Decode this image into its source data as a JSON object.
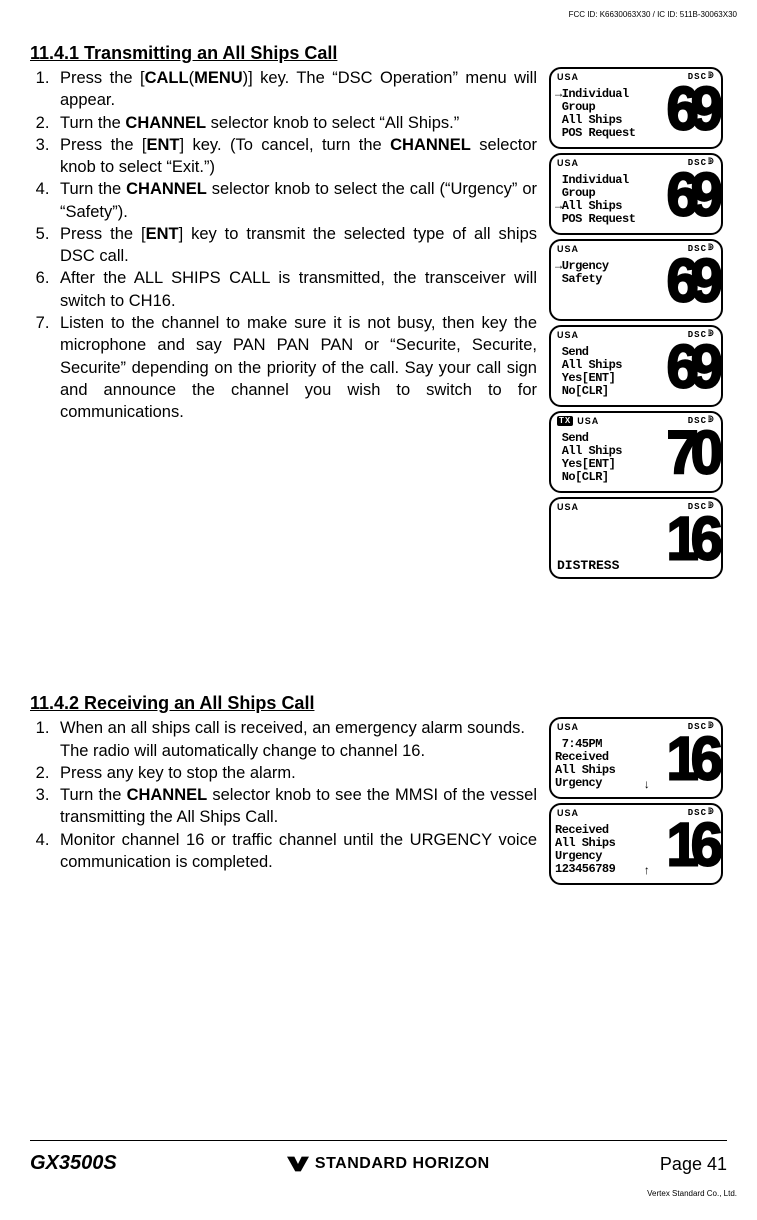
{
  "header_fine": "FCC ID: K6630063X30 / IC ID: 511B-30063X30",
  "section1": {
    "heading": "11.4.1  Transmitting an All Ships Call",
    "steps": [
      "Press the [<b>CALL</b>(<b>MENU</b>)] key. The “DSC Operation” menu will appear.",
      "Turn the <b>CHANNEL</b> selector knob to select “All Ships.”",
      "Press the [<b>ENT</b>] key. (To cancel, turn the <b>CHANNEL</b> selector knob to select “Exit.”)",
      "Turn the <b>CHANNEL</b> selector knob to select the call (“Urgency” or “Safety”).",
      "Press the [<b>ENT</b>] key to transmit the selected type of all ships DSC call.",
      "After the ALL SHIPS CALL is transmitted, the transceiver will switch to CH16.",
      "Listen to the channel to make sure it is not busy, then key the microphone and say PAN PAN PAN or “Securite, Securite, Securite” depending on the priority of the call. Say your call sign and announce the channel you wish to switch to for communications."
    ]
  },
  "section2": {
    "heading": "11.4.2 Receiving an All Ships Call",
    "steps": [
      "When an all ships call is received, an emergency alarm sounds.<br>The radio will automatically change to channel 16.",
      "Press any key to stop the alarm.",
      "Turn the <b>CHANNEL</b> selector knob to see the MMSI of the vessel transmitting the All Ships Call.",
      "Monitor channel 16 or traffic channel until the URGENCY voice communication is completed."
    ]
  },
  "lcds_top": [
    {
      "tx": false,
      "menu": "→Individual\n Group\n All Ships\n POS Request",
      "num": "69"
    },
    {
      "tx": false,
      "menu": " Individual\n Group\n→All Ships\n POS Request",
      "num": "69"
    },
    {
      "tx": false,
      "menu": "→Urgency\n Safety",
      "num": "69"
    },
    {
      "tx": false,
      "menu": " Send\n All Ships\n Yes[ENT]\n No[CLR]",
      "num": "69"
    },
    {
      "tx": true,
      "menu": " Send\n All Ships\n Yes[ENT]\n No[CLR]",
      "num": "70"
    },
    {
      "tx": false,
      "menu": "",
      "num": "16",
      "bottom": "DISTRESS"
    }
  ],
  "lcds_bottom": [
    {
      "tx": false,
      "menu": " 7:45PM\nReceived\nAll Ships\nUrgency",
      "num": "16",
      "arrow": "down"
    },
    {
      "tx": false,
      "menu": "Received\nAll Ships\nUrgency\n123456789",
      "num": "16",
      "arrow": "up"
    }
  ],
  "footer": {
    "model": "GX3500S",
    "brand": "STANDARD HORIZON",
    "page": "Page 41",
    "fine": "Vertex Standard Co., Ltd."
  }
}
